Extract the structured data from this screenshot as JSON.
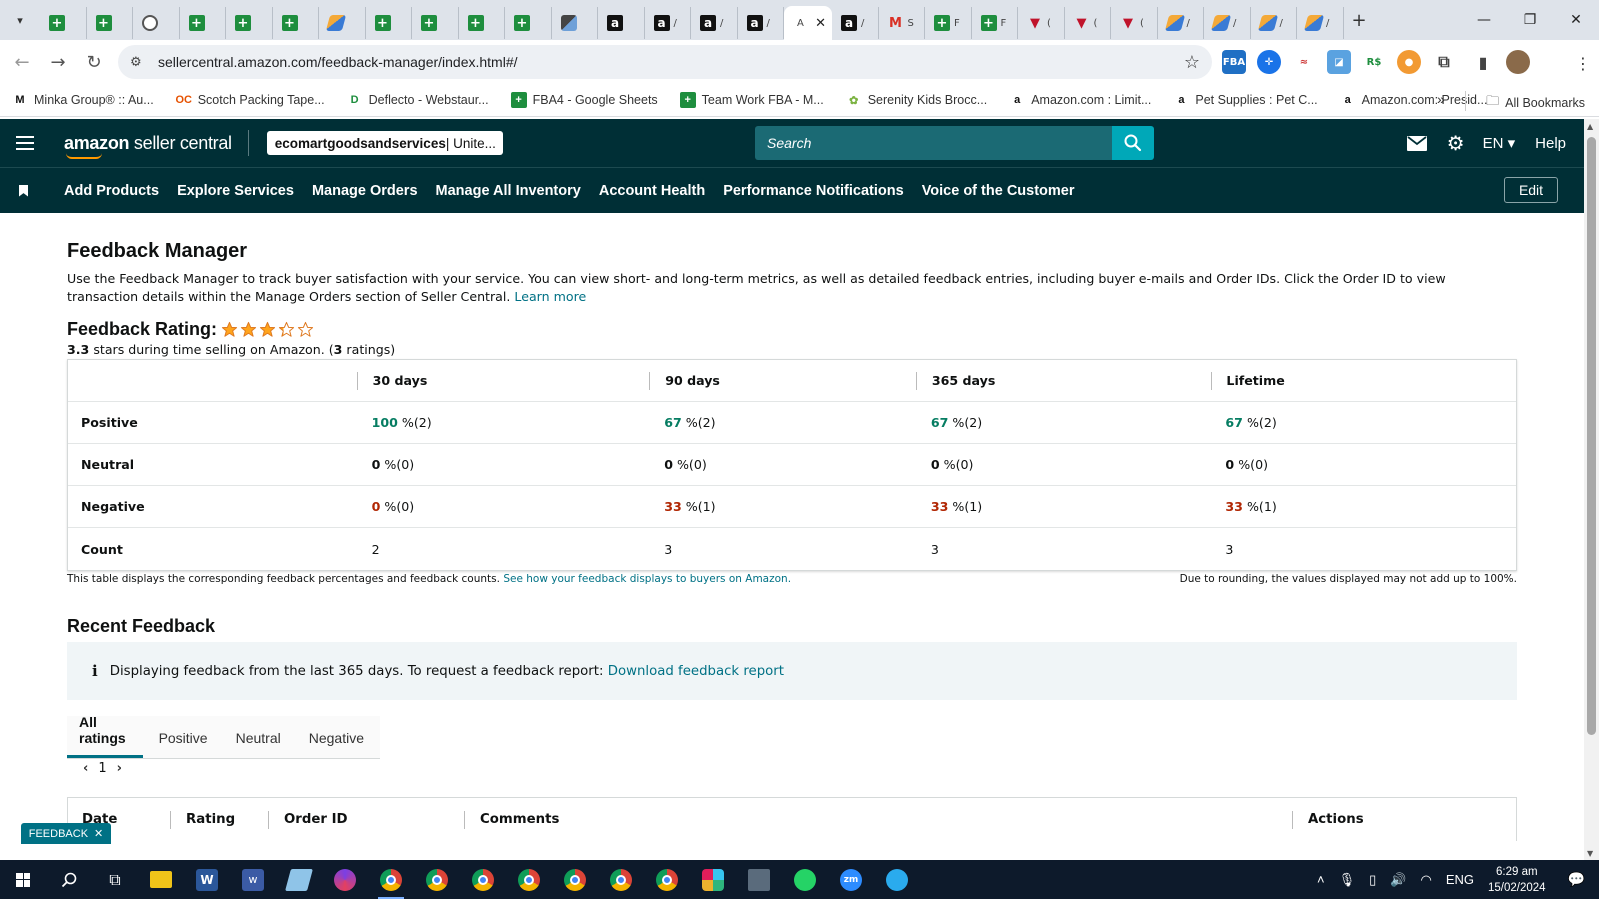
{
  "browser": {
    "active_tab_label": "A",
    "tabs": [
      {
        "icon": "sheets",
        "label": ""
      },
      {
        "icon": "sheets",
        "label": ""
      },
      {
        "icon": "globe",
        "label": ""
      },
      {
        "icon": "sheets",
        "label": ""
      },
      {
        "icon": "sheets",
        "label": ""
      },
      {
        "icon": "sheets",
        "label": ""
      },
      {
        "icon": "pencil",
        "label": ""
      },
      {
        "icon": "sheets",
        "label": ""
      },
      {
        "icon": "sheets",
        "label": ""
      },
      {
        "icon": "sheets",
        "label": ""
      },
      {
        "icon": "sheets",
        "label": ""
      },
      {
        "icon": "cube",
        "label": ""
      },
      {
        "icon": "amz",
        "label": ""
      },
      {
        "icon": "amz",
        "label": "/"
      },
      {
        "icon": "amz",
        "label": "/"
      },
      {
        "icon": "amz",
        "label": "/"
      },
      {
        "icon": "active",
        "label": "A"
      },
      {
        "icon": "amz",
        "label": "/"
      },
      {
        "icon": "gmail",
        "label": "S"
      },
      {
        "icon": "sheets",
        "label": "F"
      },
      {
        "icon": "sheets",
        "label": "F"
      },
      {
        "icon": "redv",
        "label": "("
      },
      {
        "icon": "redv",
        "label": "("
      },
      {
        "icon": "redv",
        "label": "("
      },
      {
        "icon": "pencil",
        "label": "/"
      },
      {
        "icon": "pencil",
        "label": "/"
      },
      {
        "icon": "pencil",
        "label": "/"
      },
      {
        "icon": "pencil",
        "label": "/"
      }
    ],
    "url": "sellercentral.amazon.com/feedback-manager/index.html#/",
    "bookmarks": [
      {
        "icon": "M",
        "label": "Minka Group® :: Au..."
      },
      {
        "icon": "OC",
        "label": "Scotch Packing Tape..."
      },
      {
        "icon": "D",
        "label": "Deflecto - Webstaur..."
      },
      {
        "icon": "+",
        "label": "FBA4 - Google Sheets"
      },
      {
        "icon": "+",
        "label": "Team Work FBA - M..."
      },
      {
        "icon": "✿",
        "label": "Serenity Kids Brocc..."
      },
      {
        "icon": "a",
        "label": "Amazon.com : Limit..."
      },
      {
        "icon": "a",
        "label": "Pet Supplies : Pet C..."
      },
      {
        "icon": "a",
        "label": "Amazon.com: Presid..."
      }
    ],
    "all_bookmarks": "All Bookmarks",
    "more": "»"
  },
  "header": {
    "logo_bold": "amazon",
    "logo_rest": " seller central",
    "account_name": "ecomartgoodsandservices",
    "account_region": " | Unite...",
    "search_placeholder": "Search",
    "lang": "EN ▾",
    "help": "Help"
  },
  "nav": {
    "links": [
      "Add Products",
      "Explore Services",
      "Manage Orders",
      "Manage All Inventory",
      "Account Health",
      "Performance Notifications",
      "Voice of the Customer"
    ],
    "edit": "Edit"
  },
  "page": {
    "title": "Feedback Manager",
    "intro": "Use the Feedback Manager to track buyer satisfaction with your service. You can view short- and long-term metrics, as well as detailed feedback entries, including buyer e-mails and Order IDs. Click the Order ID to view transaction details within the Manage Orders section of Seller Central.",
    "learn_more": "Learn more",
    "rating_label": "Feedback Rating:",
    "rating_stars": 3.3,
    "rating_value": "3.3",
    "rating_text": " stars during time selling on Amazon. (",
    "rating_count": "3",
    "rating_count_suffix": " ratings)",
    "table": {
      "columns": [
        "",
        "30 days",
        "90 days",
        "365 days",
        "Lifetime"
      ],
      "rows": [
        {
          "label": "Positive",
          "cells": [
            [
              "100",
              " %(2)"
            ],
            [
              "67",
              " %(2)"
            ],
            [
              "67",
              " %(2)"
            ],
            [
              "67",
              " %(2)"
            ]
          ]
        },
        {
          "label": "Neutral",
          "cells": [
            [
              "0",
              " %(0)"
            ],
            [
              "0",
              " %(0)"
            ],
            [
              "0",
              " %(0)"
            ],
            [
              "0",
              " %(0)"
            ]
          ]
        },
        {
          "label": "Negative",
          "cells": [
            [
              "0",
              " %(0)"
            ],
            [
              "33",
              " %(1)"
            ],
            [
              "33",
              " %(1)"
            ],
            [
              "33",
              " %(1)"
            ]
          ]
        },
        {
          "label": "Count",
          "cells": [
            [
              "",
              "2"
            ],
            [
              "",
              "3"
            ],
            [
              "",
              "3"
            ],
            [
              "",
              "3"
            ]
          ]
        }
      ]
    },
    "note_left": "This table displays the corresponding feedback percentages and feedback counts. ",
    "note_link": "See how your feedback displays to buyers on Amazon.",
    "note_right": "Due to rounding, the values displayed may not add up to 100%.",
    "recent_title": "Recent Feedback",
    "info_text": "Displaying feedback from the last 365 days. To request a feedback report: ",
    "info_link": "Download feedback report",
    "filter_tabs": [
      "All ratings",
      "Positive",
      "Neutral",
      "Negative"
    ],
    "page_number": "1",
    "list_columns": [
      "Date",
      "Rating",
      "Order ID",
      "Comments",
      "Actions"
    ],
    "feedback_tab": "FEEDBACK"
  },
  "colors": {
    "header_bg": "#002f36",
    "positive": "#067d62",
    "negative": "#b12704",
    "link": "#007185",
    "star": "#ffa41c"
  },
  "taskbar": {
    "lang": "ENG",
    "time": "6:29 am",
    "date": "15/02/2024"
  }
}
